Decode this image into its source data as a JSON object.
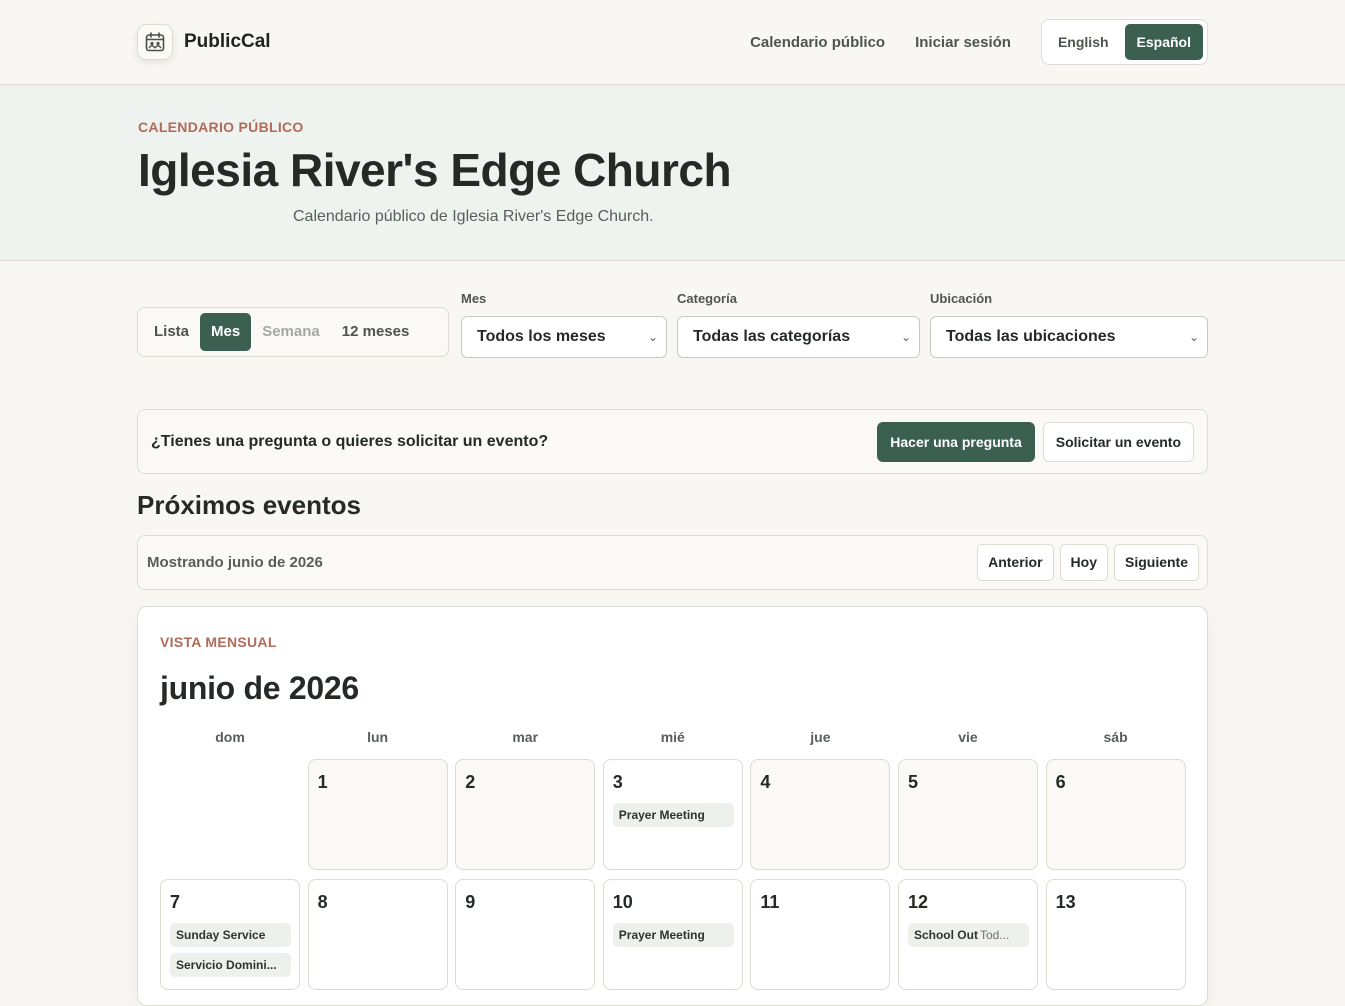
{
  "app": {
    "name": "PublicCal",
    "logo_icon": "calendar-people-icon"
  },
  "nav": {
    "links": [
      "Calendario público",
      "Iniciar sesión"
    ],
    "languages": [
      {
        "label": "English",
        "active": false
      },
      {
        "label": "Español",
        "active": true
      }
    ]
  },
  "hero": {
    "eyebrow": "CALENDARIO PÚBLICO",
    "title": "Iglesia River's Edge Church",
    "subtitle": "Calendario público de Iglesia River's Edge Church."
  },
  "views": {
    "tabs": [
      {
        "label": "Lista",
        "active": false
      },
      {
        "label": "Mes",
        "active": true
      },
      {
        "label": "Semana",
        "active": false,
        "muted": true
      },
      {
        "label": "12 meses",
        "active": false
      }
    ]
  },
  "filters": {
    "month": {
      "label": "Mes",
      "value": "Todos los meses"
    },
    "category": {
      "label": "Categoría",
      "value": "Todas las categorías"
    },
    "location": {
      "label": "Ubicación",
      "value": "Todas las ubicaciones"
    }
  },
  "ask": {
    "text": "¿Tienes una pregunta o quieres solicitar un evento?",
    "ask_button": "Hacer una pregunta",
    "request_button": "Solicitar un evento"
  },
  "upcoming": {
    "title": "Próximos eventos",
    "showing": "Mostrando junio de 2026",
    "prev": "Anterior",
    "today": "Hoy",
    "next": "Siguiente"
  },
  "month": {
    "eyebrow": "VISTA MENSUAL",
    "title": "junio de 2026",
    "weekdays": [
      "dom",
      "lun",
      "mar",
      "mié",
      "jue",
      "vie",
      "sáb"
    ],
    "days": [
      {
        "num": "",
        "events": []
      },
      {
        "num": "1",
        "events": []
      },
      {
        "num": "2",
        "events": []
      },
      {
        "num": "3",
        "events": [
          {
            "title": "Prayer Meeting"
          }
        ]
      },
      {
        "num": "4",
        "events": []
      },
      {
        "num": "5",
        "events": []
      },
      {
        "num": "6",
        "events": []
      },
      {
        "num": "7",
        "events": [
          {
            "title": "Sunday Service"
          },
          {
            "title": "Servicio Domini..."
          }
        ]
      },
      {
        "num": "8",
        "events": []
      },
      {
        "num": "9",
        "events": []
      },
      {
        "num": "10",
        "events": [
          {
            "title": "Prayer Meeting"
          }
        ]
      },
      {
        "num": "11",
        "events": []
      },
      {
        "num": "12",
        "events": [
          {
            "title": "School Out",
            "time": "Tod..."
          }
        ]
      },
      {
        "num": "13",
        "events": []
      }
    ]
  }
}
